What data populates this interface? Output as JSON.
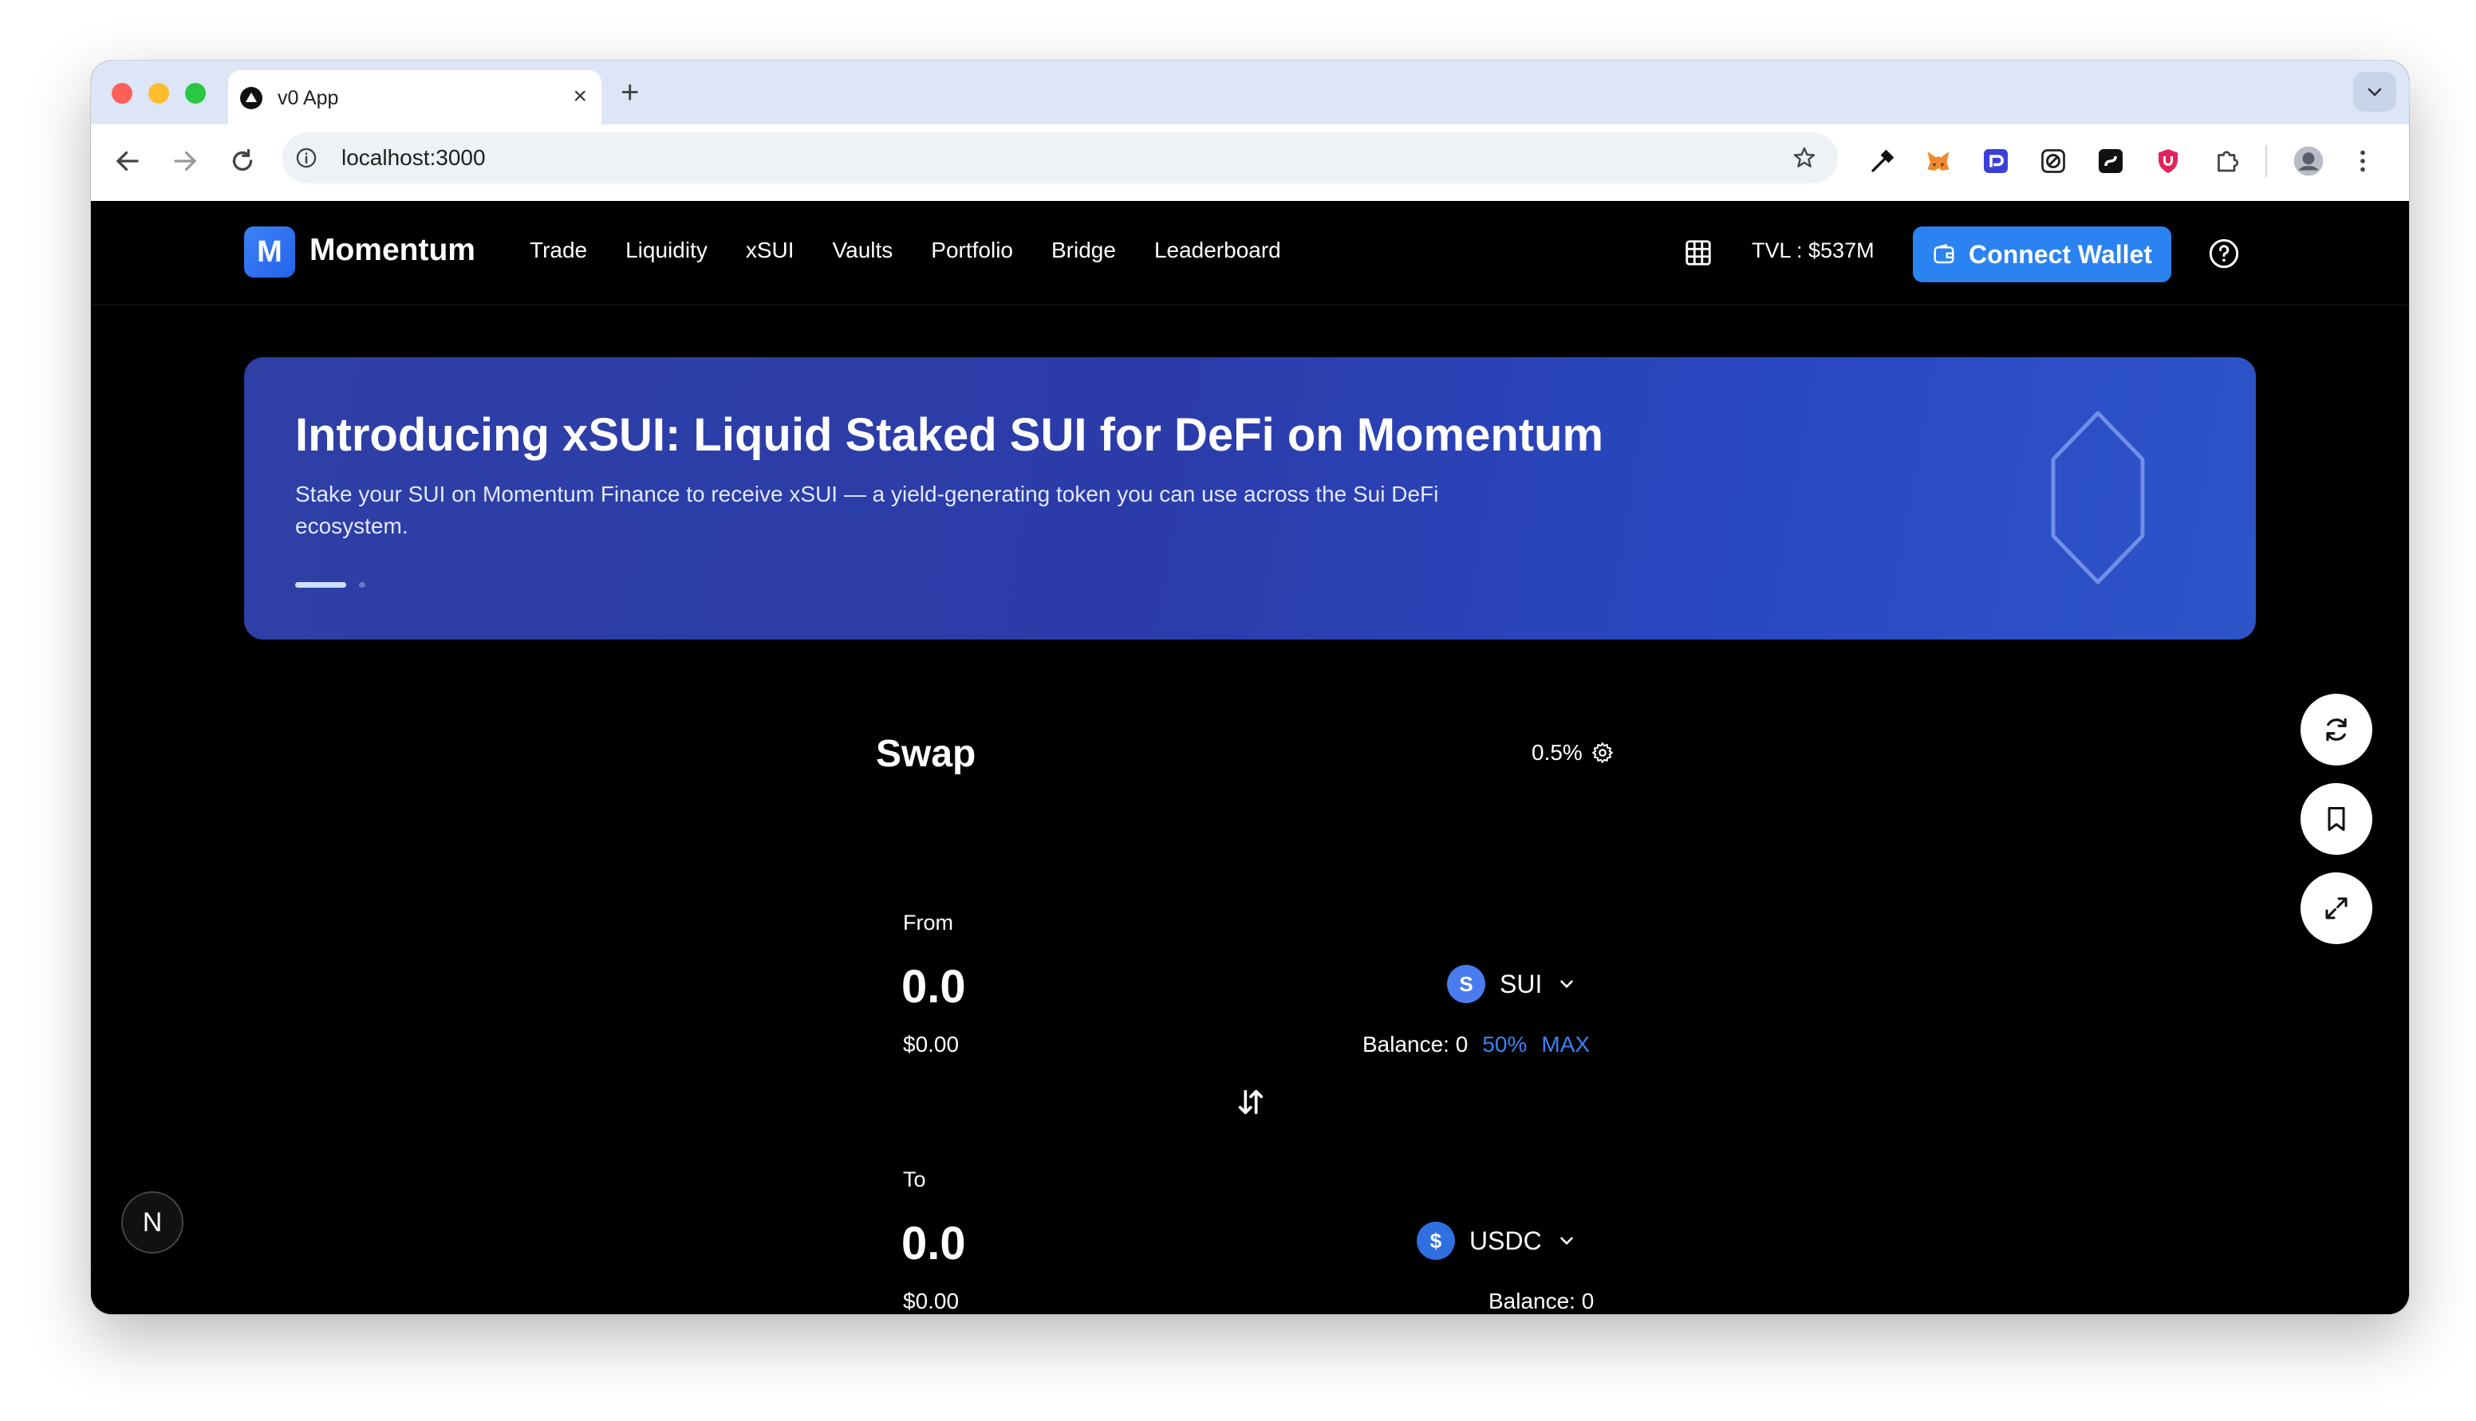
{
  "browser": {
    "tab_title": "v0 App",
    "new_tab": "+",
    "url": "localhost:3000"
  },
  "app": {
    "logo_letter": "M",
    "name": "Momentum",
    "nav": [
      "Trade",
      "Liquidity",
      "xSUI",
      "Vaults",
      "Portfolio",
      "Bridge",
      "Leaderboard"
    ],
    "tvl": "TVL : $537M",
    "connect_label": "Connect Wallet",
    "accent": "#2a83f0"
  },
  "banner": {
    "title": "Introducing xSUI: Liquid Staked SUI for DeFi on Momentum",
    "description": "Stake your SUI on Momentum Finance to receive xSUI — a yield-generating token you can use across the Sui DeFi ecosystem."
  },
  "swap": {
    "title": "Swap",
    "slippage": "0.5%",
    "from": {
      "label": "From",
      "amount": "0.0",
      "usd": "$0.00",
      "token": "SUI",
      "token_icon_letter": "S",
      "balance": "Balance: 0",
      "pct_50": "50%",
      "max": "MAX"
    },
    "to": {
      "label": "To",
      "amount": "0.0",
      "usd": "$0.00",
      "token": "USDC",
      "token_icon_letter": "$",
      "balance": "Balance: 0"
    }
  },
  "dev_badge": "N"
}
